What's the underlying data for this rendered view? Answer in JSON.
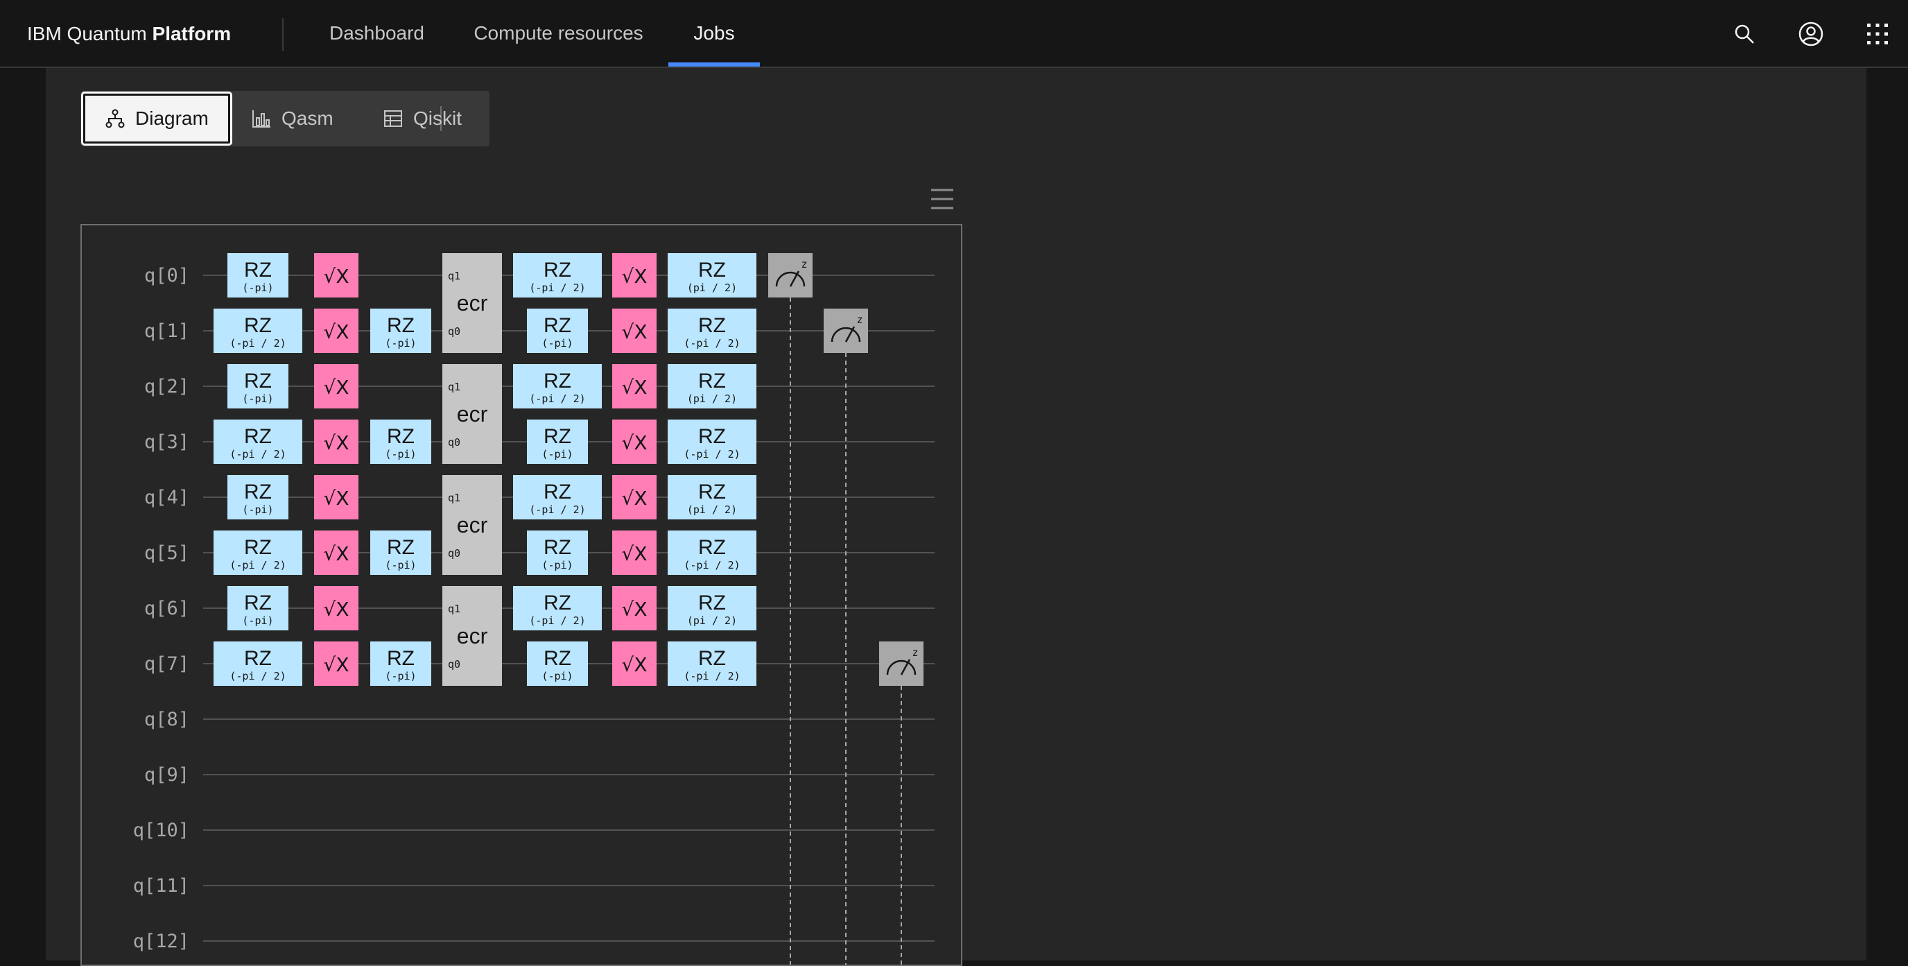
{
  "header": {
    "brand_prefix": "IBM Quantum ",
    "brand_bold": "Platform",
    "nav": [
      "Dashboard",
      "Compute resources",
      "Jobs"
    ],
    "active_nav": "Jobs",
    "icons": [
      "search-icon",
      "user-avatar-icon",
      "app-switcher-icon"
    ]
  },
  "view_switcher": {
    "options": [
      {
        "label": "Diagram",
        "icon": "tree-diagram-icon",
        "selected": true
      },
      {
        "label": "Qasm",
        "icon": "bar-chart-icon",
        "selected": false
      },
      {
        "label": "Qiskit",
        "icon": "table-icon",
        "selected": false
      }
    ]
  },
  "circuit": {
    "qubits": [
      "q[0]",
      "q[1]",
      "q[2]",
      "q[3]",
      "q[4]",
      "q[5]",
      "q[6]",
      "q[7]",
      "q[8]",
      "q[9]",
      "q[10]",
      "q[11]",
      "q[12]"
    ],
    "colors": {
      "rz": "#bae6ff",
      "sx": "#ff7eb6",
      "ecr": "#c6c6c6",
      "measure": "#a8a8a8",
      "wire": "#525252"
    },
    "gate_labels": {
      "rz": "RZ",
      "sx": "√X",
      "ecr": "ecr",
      "measure_basis": "z",
      "pin_top": "q1",
      "pin_bottom": "q0"
    },
    "gates": [
      {
        "type": "rz",
        "qubit": 0,
        "col": 1,
        "param": "(-pi)"
      },
      {
        "type": "sx",
        "qubit": 0,
        "col": 2
      },
      {
        "type": "rz",
        "qubit": 1,
        "col": 1,
        "param": "(-pi / 2)"
      },
      {
        "type": "sx",
        "qubit": 1,
        "col": 2
      },
      {
        "type": "rz",
        "qubit": 1,
        "col": 3,
        "param": "(-pi)"
      },
      {
        "type": "rz",
        "qubit": 2,
        "col": 1,
        "param": "(-pi)"
      },
      {
        "type": "sx",
        "qubit": 2,
        "col": 2
      },
      {
        "type": "rz",
        "qubit": 3,
        "col": 1,
        "param": "(-pi / 2)"
      },
      {
        "type": "sx",
        "qubit": 3,
        "col": 2
      },
      {
        "type": "rz",
        "qubit": 3,
        "col": 3,
        "param": "(-pi)"
      },
      {
        "type": "rz",
        "qubit": 4,
        "col": 1,
        "param": "(-pi)"
      },
      {
        "type": "sx",
        "qubit": 4,
        "col": 2
      },
      {
        "type": "rz",
        "qubit": 5,
        "col": 1,
        "param": "(-pi / 2)"
      },
      {
        "type": "sx",
        "qubit": 5,
        "col": 2
      },
      {
        "type": "rz",
        "qubit": 5,
        "col": 3,
        "param": "(-pi)"
      },
      {
        "type": "rz",
        "qubit": 6,
        "col": 1,
        "param": "(-pi)"
      },
      {
        "type": "sx",
        "qubit": 6,
        "col": 2
      },
      {
        "type": "rz",
        "qubit": 7,
        "col": 1,
        "param": "(-pi / 2)"
      },
      {
        "type": "sx",
        "qubit": 7,
        "col": 2
      },
      {
        "type": "rz",
        "qubit": 7,
        "col": 3,
        "param": "(-pi)"
      },
      {
        "type": "ecr",
        "qubits": [
          0,
          1
        ],
        "col": 4
      },
      {
        "type": "ecr",
        "qubits": [
          2,
          3
        ],
        "col": 4
      },
      {
        "type": "ecr",
        "qubits": [
          4,
          5
        ],
        "col": 4
      },
      {
        "type": "ecr",
        "qubits": [
          6,
          7
        ],
        "col": 4
      },
      {
        "type": "rz",
        "qubit": 0,
        "col": 5,
        "param": "(-pi / 2)"
      },
      {
        "type": "sx",
        "qubit": 0,
        "col": 6
      },
      {
        "type": "rz",
        "qubit": 0,
        "col": 7,
        "param": "(pi / 2)"
      },
      {
        "type": "rz",
        "qubit": 1,
        "col": 5,
        "param": "(-pi)"
      },
      {
        "type": "sx",
        "qubit": 1,
        "col": 6
      },
      {
        "type": "rz",
        "qubit": 1,
        "col": 7,
        "param": "(-pi / 2)"
      },
      {
        "type": "rz",
        "qubit": 2,
        "col": 5,
        "param": "(-pi / 2)"
      },
      {
        "type": "sx",
        "qubit": 2,
        "col": 6
      },
      {
        "type": "rz",
        "qubit": 2,
        "col": 7,
        "param": "(pi / 2)"
      },
      {
        "type": "rz",
        "qubit": 3,
        "col": 5,
        "param": "(-pi)"
      },
      {
        "type": "sx",
        "qubit": 3,
        "col": 6
      },
      {
        "type": "rz",
        "qubit": 3,
        "col": 7,
        "param": "(-pi / 2)"
      },
      {
        "type": "rz",
        "qubit": 4,
        "col": 5,
        "param": "(-pi / 2)"
      },
      {
        "type": "sx",
        "qubit": 4,
        "col": 6
      },
      {
        "type": "rz",
        "qubit": 4,
        "col": 7,
        "param": "(pi / 2)"
      },
      {
        "type": "rz",
        "qubit": 5,
        "col": 5,
        "param": "(-pi)"
      },
      {
        "type": "sx",
        "qubit": 5,
        "col": 6
      },
      {
        "type": "rz",
        "qubit": 5,
        "col": 7,
        "param": "(-pi / 2)"
      },
      {
        "type": "rz",
        "qubit": 6,
        "col": 5,
        "param": "(-pi / 2)"
      },
      {
        "type": "sx",
        "qubit": 6,
        "col": 6
      },
      {
        "type": "rz",
        "qubit": 6,
        "col": 7,
        "param": "(pi / 2)"
      },
      {
        "type": "rz",
        "qubit": 7,
        "col": 5,
        "param": "(-pi)"
      },
      {
        "type": "sx",
        "qubit": 7,
        "col": 6
      },
      {
        "type": "rz",
        "qubit": 7,
        "col": 7,
        "param": "(-pi / 2)"
      },
      {
        "type": "measure",
        "qubit": 0,
        "col": 8
      },
      {
        "type": "measure",
        "qubit": 1,
        "col": 9
      },
      {
        "type": "measure",
        "qubit": 7,
        "col": 10
      }
    ]
  }
}
